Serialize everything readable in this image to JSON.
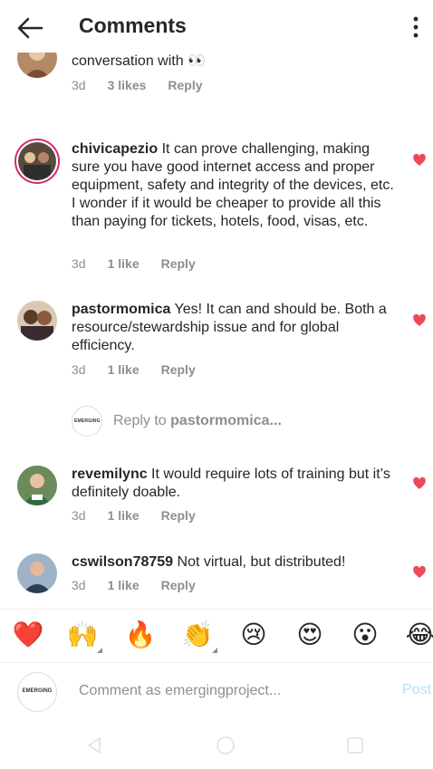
{
  "header": {
    "title": "Comments"
  },
  "comments": [
    {
      "username": "",
      "text": "conferences elected more young folk to be in conversation with 👀",
      "time": "3d",
      "likes": "3 likes",
      "reply": "Reply"
    },
    {
      "username": "chivicapezio",
      "text": " It can prove challenging, making sure you have good internet access and proper equipment, safety and integrity of the devices, etc. I wonder if it would be cheaper to provide all this than paying for tickets, hotels, food, visas, etc.",
      "time": "3d",
      "likes": "1 like",
      "reply": "Reply"
    },
    {
      "username": "pastormomica",
      "text": " Yes! It can and should be. Both a resource/stewardship issue and for global efficiency.",
      "time": "3d",
      "likes": "1 like",
      "reply": "Reply"
    },
    {
      "username": "revemilync",
      "text": " It would require lots of training but it’s definitely doable.",
      "time": "3d",
      "likes": "1 like",
      "reply": "Reply"
    },
    {
      "username": "cswilson78759",
      "text": " Not virtual, but distributed!",
      "time": "3d",
      "likes": "1 like",
      "reply": "Reply"
    }
  ],
  "reply_prompt": {
    "prefix": "Reply to ",
    "target": "pastormomica...",
    "avatar_text": "EMERGING"
  },
  "emoji_bar": [
    "❤️",
    "🙌",
    "🔥",
    "👏",
    "😢",
    "😍",
    "😮",
    "😂"
  ],
  "comment_bar": {
    "avatar_text": "EMERGING",
    "placeholder": "Comment as emergingproject...",
    "post_label": "Post"
  },
  "colors": {
    "heart": "#ed4956",
    "meta": "#8e8e8e",
    "post_disabled": "#b2dffc",
    "story_ring": "#d62976"
  },
  "icons": {
    "back": "arrow-left-icon",
    "more": "vertical-dots-icon",
    "heart": "heart-filled-icon",
    "nav_back": "triangle-back-icon",
    "nav_home": "circle-home-icon",
    "nav_recent": "square-recents-icon"
  }
}
